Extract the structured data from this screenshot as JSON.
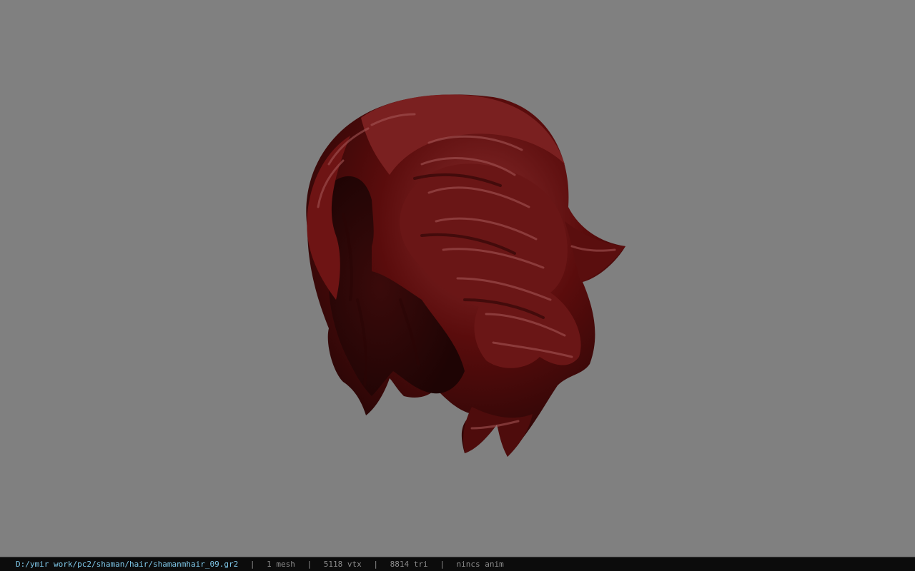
{
  "viewer": {
    "background_color": "#808080",
    "model": {
      "name": "shamanmhair_09",
      "base_color": "#5a0c0c",
      "highlight_color": "#a85a5a"
    }
  },
  "status": {
    "file_path": "D:/ymir work/pc2/shaman/hair/shamanmhair_09.gr2",
    "separator": "|",
    "mesh_count": "1 mesh",
    "vertex_count": "5118 vtx",
    "triangle_count": "8814 tri",
    "anim_status": "nincs anim"
  }
}
